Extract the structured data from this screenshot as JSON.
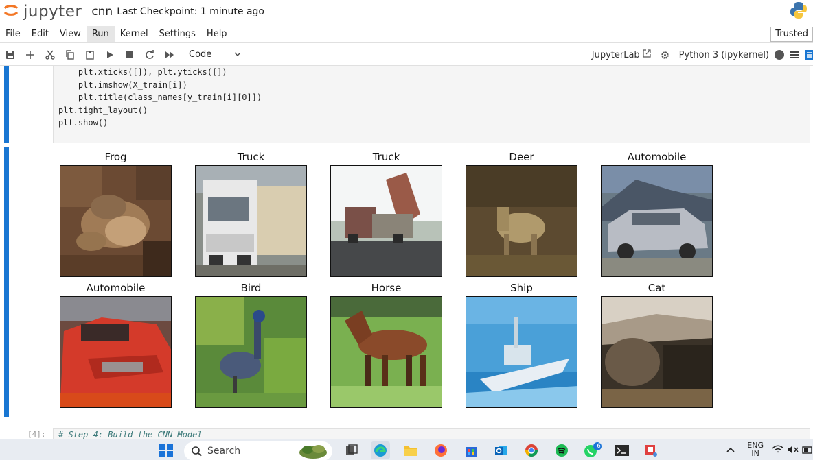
{
  "header": {
    "logo_text": "jupyter",
    "notebook_name": "cnn",
    "checkpoint": "Last Checkpoint: 1 minute ago"
  },
  "menu": {
    "items": [
      "File",
      "Edit",
      "View",
      "Run",
      "Kernel",
      "Settings",
      "Help"
    ],
    "active": "Run",
    "trusted_label": "Trusted"
  },
  "toolbar": {
    "cell_type": "Code",
    "jupyterlab_label": "JupyterLab",
    "kernel_name": "Python 3 (ipykernel)"
  },
  "code_cell": {
    "lines": [
      "    plt.xticks([]), plt.yticks([])",
      "    plt.imshow(X_train[i])",
      "    plt.title(class_names[y_train[i][0]])",
      "plt.tight_layout()",
      "plt.show()"
    ]
  },
  "output": {
    "titles": [
      "Frog",
      "Truck",
      "Truck",
      "Deer",
      "Automobile",
      "Automobile",
      "Bird",
      "Horse",
      "Ship",
      "Cat"
    ]
  },
  "next_cell": {
    "prompt": "[4]:",
    "comment": "# Step 4: Build the CNN Model"
  },
  "taskbar": {
    "search_placeholder": "Search",
    "lang_line1": "ENG",
    "lang_line2": "IN",
    "badge_count": "6"
  }
}
